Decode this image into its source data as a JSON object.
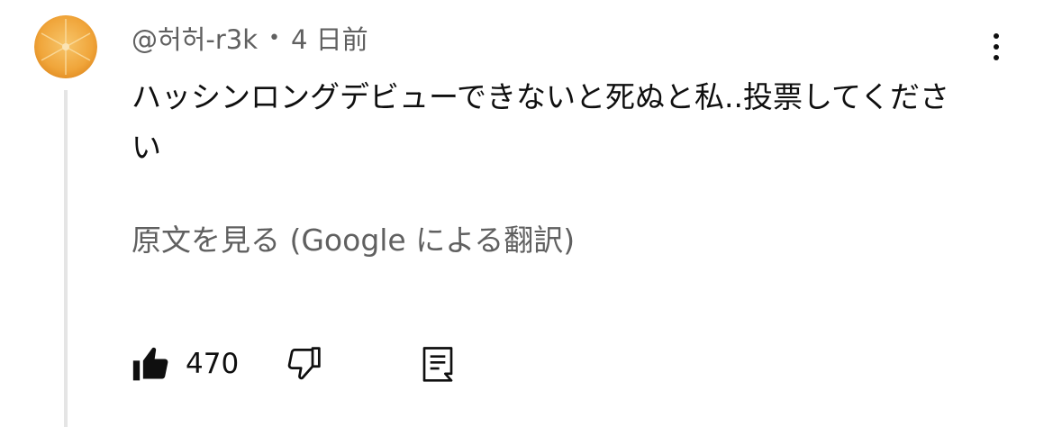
{
  "comment": {
    "author": "@허허-r3k",
    "separator": "•",
    "time": "4 日前",
    "text": "ハッシンロングデビューできないと死ぬと私..投票してください",
    "translation_link": "原文を見る (Google による翻訳)",
    "like_count": "470"
  },
  "icons": {
    "avatar": "orange-avatar",
    "menu": "more-vert-icon",
    "like": "thumbs-up-filled-icon",
    "dislike": "thumbs-down-outline-icon",
    "reply": "reply-comment-icon"
  },
  "colors": {
    "text": "#0f0f0f",
    "secondary": "#606060",
    "thread_line": "#e5e5e5",
    "avatar_orange": "#f0a53a"
  }
}
